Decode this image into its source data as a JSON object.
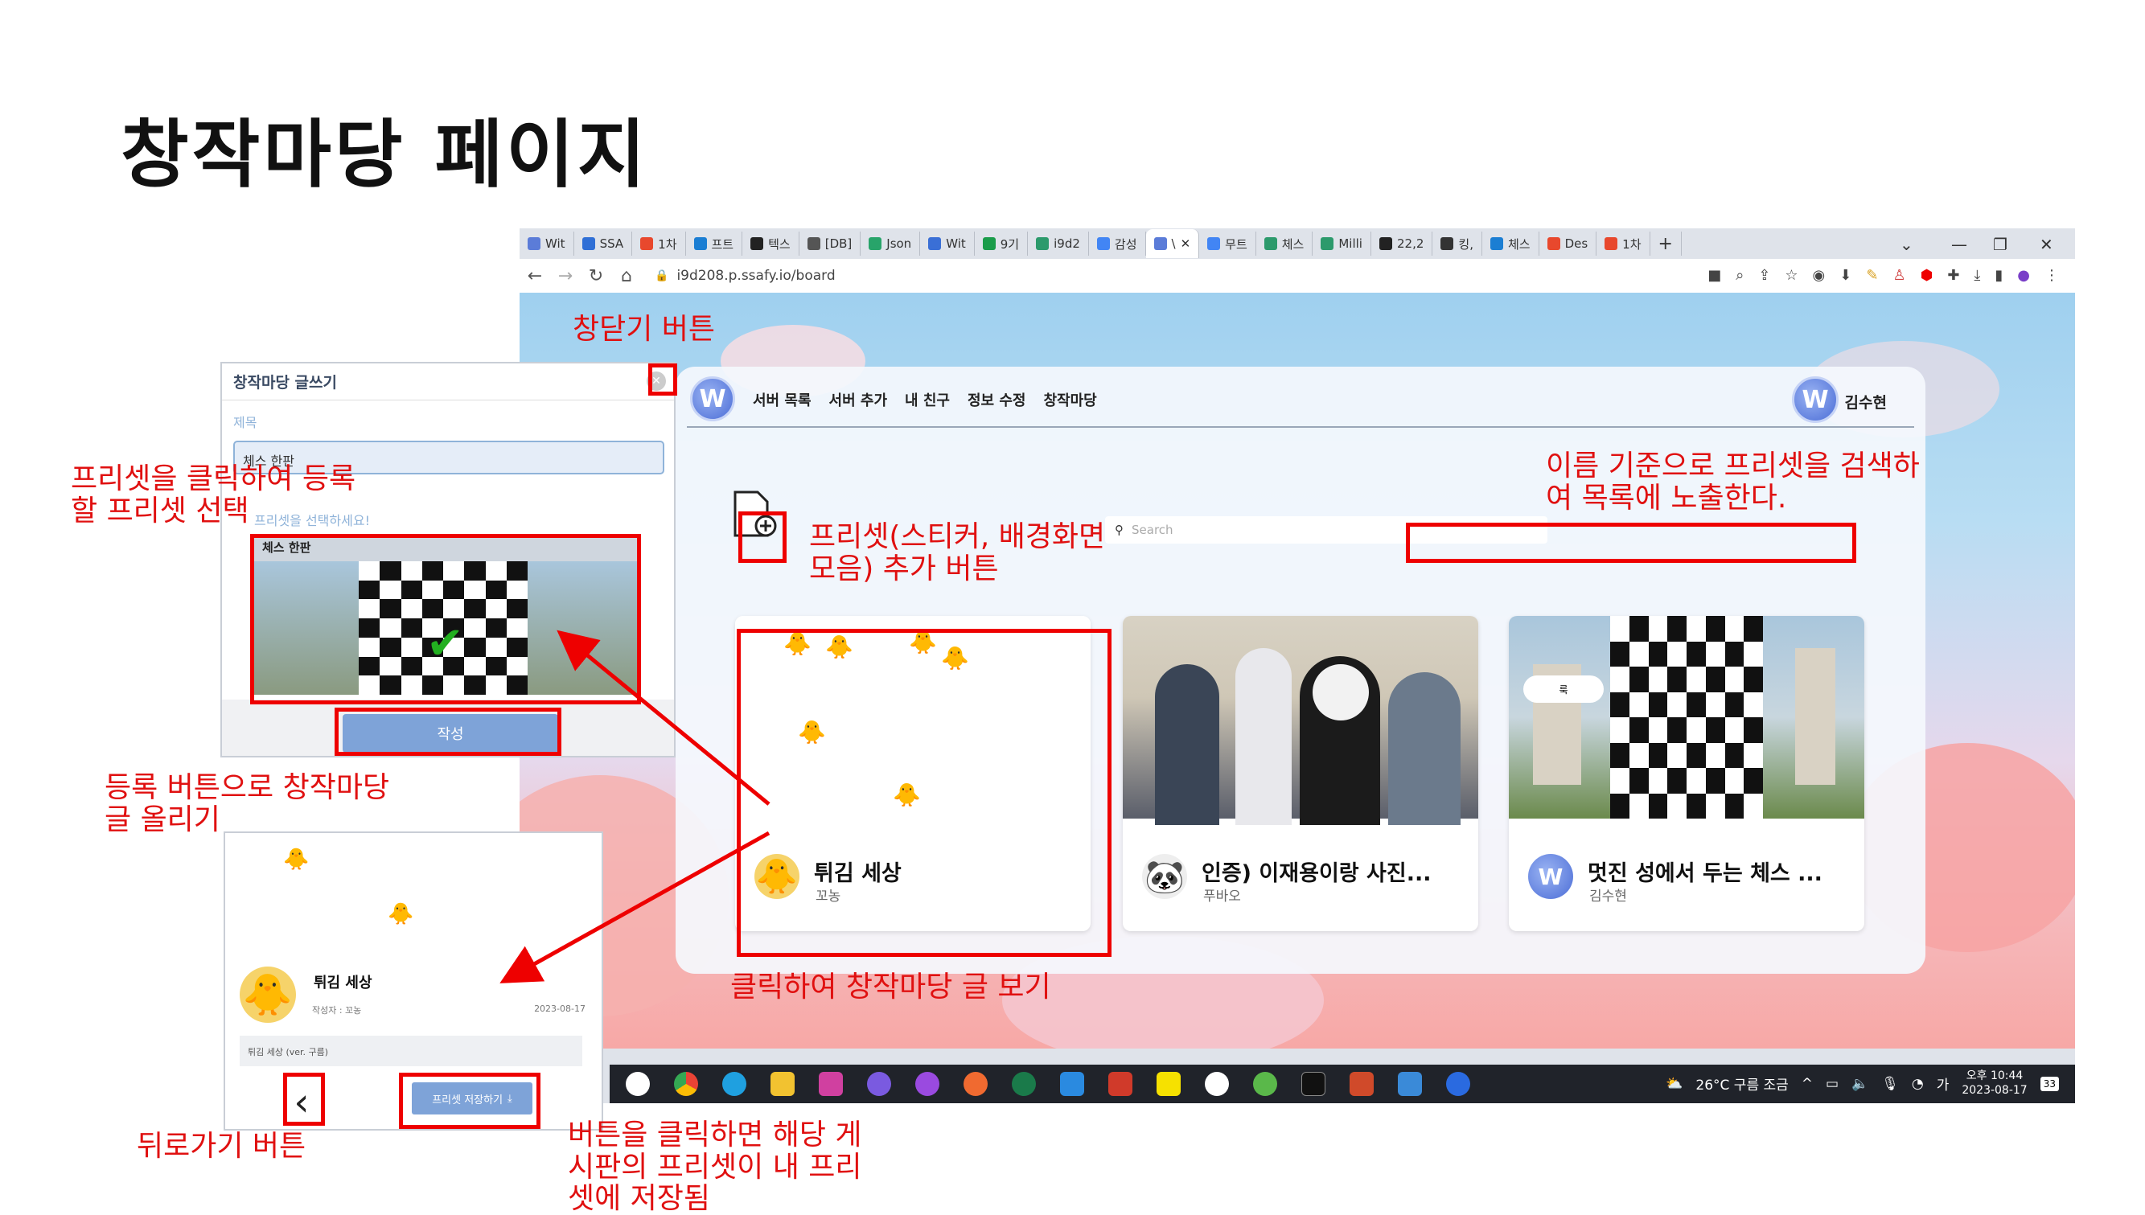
{
  "slide": {
    "title": "창작마당 페이지"
  },
  "browser": {
    "tabs": [
      {
        "label": "Wit",
        "color": "#5b7cd8"
      },
      {
        "label": "SSA",
        "color": "#2f6fd6"
      },
      {
        "label": "1차",
        "color": "#e8482d"
      },
      {
        "label": "프트",
        "color": "#1b7ed3"
      },
      {
        "label": "텍스",
        "color": "#222222"
      },
      {
        "label": "[DB]",
        "color": "#555555"
      },
      {
        "label": "Json",
        "color": "#28a46a"
      },
      {
        "label": "Wit",
        "color": "#3a6fd6"
      },
      {
        "label": "9기",
        "color": "#1a9c4a"
      },
      {
        "label": "i9d2",
        "color": "#2c9a6c"
      },
      {
        "label": "감성",
        "color": "#4285f4"
      },
      {
        "label": "\\",
        "color": "#5b7cd8",
        "active": true
      },
      {
        "label": "무트",
        "color": "#4285f4"
      },
      {
        "label": "체스",
        "color": "#2c9a6c"
      },
      {
        "label": "Milli",
        "color": "#2c9a6c"
      },
      {
        "label": "22,2",
        "color": "#222222"
      },
      {
        "label": "킹,",
        "color": "#333333"
      },
      {
        "label": "체스",
        "color": "#1b7ed3"
      },
      {
        "label": "Des",
        "color": "#e8482d"
      },
      {
        "label": "1차",
        "color": "#e8482d"
      }
    ],
    "url": "i9d208.p.ssafy.io/board"
  },
  "site": {
    "logo_letter": "W",
    "menu": [
      "서버 목록",
      "서버 추가",
      "내 친구",
      "정보 수정",
      "창작마당"
    ],
    "user_name": "김수현",
    "search_placeholder": "Search",
    "cards": [
      {
        "title": "튀김 세상",
        "author": "꼬농",
        "avatar_emoji": "🐥"
      },
      {
        "title": "인증) 이재용이랑 사진...",
        "author": "푸바오",
        "avatar_emoji": "🐼"
      },
      {
        "title": "멋진 성에서 두는 체스 ...",
        "author": "김수현",
        "avatar_emoji": "W"
      }
    ]
  },
  "taskbar": {
    "weather": "26°C 구름 조금",
    "time": "오후 10:44",
    "date": "2023-08-17",
    "notif_count": "33",
    "ime": "가"
  },
  "write_modal": {
    "header": "창작마당 글쓰기",
    "title_label": "제목",
    "title_value": "체스 한판",
    "preset_hint": "프리셋을 선택하세요!",
    "preset_name": "체스 한판",
    "submit_label": "작성"
  },
  "detail": {
    "title": "튀김 세상",
    "author": "작성자 : 꼬농",
    "date": "2023-08-17",
    "description": "튀김 세상 (ver. 구름)",
    "save_label": "프리셋 저장하기"
  },
  "annotations": {
    "close_btn": "창닫기 버튼",
    "select_preset": "프리셋을 클릭하여 등록\n할 프리셋 선택",
    "submit_post": "등록 버튼으로 창작마당\n글 올리기",
    "back_btn": "뒤로가기 버튼",
    "save_preset": "버튼을 클릭하면 해당 게\n시판의 프리셋이 내 프리\n셋에 저장됨",
    "add_preset": "프리셋(스티커, 배경화면\n모음) 추가 버튼",
    "search_desc": "이름 기준으로 프리셋을 검색하\n여 목록에 노출한다.",
    "view_post": "클릭하여 창작마당 글 보기"
  },
  "colors": {
    "annotation": "#e01010",
    "accent_button": "#7ea3d8"
  }
}
